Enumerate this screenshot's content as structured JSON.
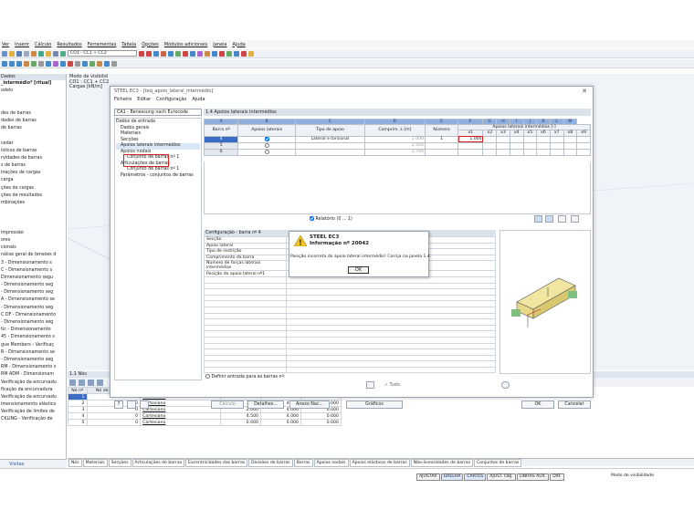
{
  "menu": [
    "Ver",
    "Inserir",
    "Cálculo",
    "Resultados",
    "Ferramentas",
    "Tabela",
    "Opções",
    "Módulos adicionais",
    "Janela",
    "Ajuda"
  ],
  "toolbar": {
    "combo": "CO1 - CC1 + CC2"
  },
  "nav": {
    "header": "Dados",
    "items": [
      "_intermédio* [ritual]",
      "odelo",
      "",
      "",
      "des de barras",
      "dades de barras",
      "de barras",
      "",
      "cedar",
      "ísticos de barras",
      "rvidades de barras",
      "s de barras",
      "inações de cargas",
      "carga",
      "ções de cargas",
      "ções de resultados",
      "mbinações",
      "",
      "",
      "",
      "impressão",
      "ores",
      "cionais",
      "nálise geral de tensões d",
      "3 - Dimensionamento s",
      "C - Dimensionamento s",
      "Dimensionamento segu",
      "- Dimensionamento seg",
      "- Dimensionamento seg",
      "A - Dimensionamento se",
      "- Dimensionamento seg",
      "C DF - Dimensionamento",
      "- Dimensionamento seg",
      "tic - Dimensionamento",
      "45 - Dimensionamento s",
      "gue Members - Verificaç",
      "R - Dimensionamento se",
      "- Dimensionamento seg",
      "RM - Dimensionamento s",
      "RM ADM - Dimensionam",
      "Verificação da encurvadu",
      "ficação da encurvadura",
      "Verificação da encurvadu",
      "imensionamento elástico",
      "Verificação de limites de",
      "CKLING - Verificação de"
    ],
    "footer": "Visitas"
  },
  "canvas_info": [
    "Modo de visibilid",
    "CO1 : CC1 + CC2",
    "Cargas [kN/m]"
  ],
  "bottom_panel": {
    "title": "1.1 Nós",
    "headers": [
      "Nó nº",
      "Nó de referência",
      "Tipo de sistema de coordenadas",
      "X [m]",
      "Y [m]",
      "Z [m]"
    ],
    "rows": [
      [
        "1",
        "0",
        "Cartesiano",
        "",
        "",
        ""
      ],
      [
        "2",
        "0",
        "Cartesiano",
        "7.200",
        "4.000",
        "0.000"
      ],
      [
        "3",
        "0",
        "Cartesiano",
        "2.000",
        "4.000",
        "0.000"
      ],
      [
        "4",
        "0",
        "Cartesiano",
        "4.500",
        "4.000",
        "0.000"
      ],
      [
        "5",
        "0",
        "Cartesiano",
        "0.000",
        "0.000",
        "0.000"
      ]
    ]
  },
  "bottom_tabs": [
    "Nós",
    "Materiais",
    "Secções",
    "Articulações de barras",
    "Excentricidades das barras",
    "Divisões de barras",
    "Barras",
    "Apoios nodais",
    "Apoios elásticos de barras",
    "Não-linearidades de barras",
    "Conjuntos de barras"
  ],
  "status": {
    "buttons": [
      "AJUSTAR",
      "GRELHA",
      "CARTES",
      "AJUST. OBJ.",
      "LINHAS AUX.",
      "DXF"
    ],
    "active": [
      "GRELHA",
      "CARTES"
    ],
    "modo": "Modo de visibilidade"
  },
  "dialog": {
    "title": "STEEL EC3 - [teq_apoio_lateral_intermédio]",
    "menu": [
      "Ficheiro",
      "Editar",
      "Configuração",
      "Ajuda"
    ],
    "combo": "CA1 - Benessung nach Eurocode",
    "section_title": "1.4 Apoios laterais intermédios",
    "tree": [
      "Dados de entrada",
      "Dados gerais",
      "Materiais",
      "Secções",
      "Apoios laterais intermédios",
      "Apoios nodais",
      "Conjunto de barras nº 1",
      "Articulações de barras",
      "Conjunto de barras nº 1",
      "Parâmetros - conjuntos de barras"
    ],
    "grid": {
      "letters": [
        "A",
        "B",
        "C",
        "D",
        "E",
        "F",
        "G",
        "H",
        "I",
        "J",
        "K",
        "L",
        "M"
      ],
      "h_barra": "Barra nº",
      "h_apoios": "Apoios laterais",
      "h_tipo": "Tipo de apoio",
      "h_compr": "Comprim. L [m]",
      "h_numero": "Número",
      "h_group": "Apoios laterais intermédios [-]",
      "xcols": [
        "x1",
        "x2",
        "x3",
        "x4",
        "x5",
        "x6",
        "x7",
        "x8",
        "x9"
      ],
      "rows": [
        {
          "n": "4",
          "checked": true,
          "tipo": "Lateral e torsional",
          "compr": "2.000",
          "num": "1",
          "x1": "1.000"
        },
        {
          "n": "5",
          "checked": false,
          "tipo": "",
          "compr": "2.500",
          "num": "",
          "x1": ""
        },
        {
          "n": "6",
          "checked": false,
          "tipo": "",
          "compr": "2.700",
          "num": "",
          "x1": ""
        }
      ]
    },
    "relatorio": "Relatório (0 ... 1)",
    "config": {
      "title": "Configuração - barra nº 4",
      "rows": [
        "Secção",
        "Apoio lateral",
        "Tipo de restrição",
        "Comprimento da barra",
        "Número de forças laterais intermédias",
        "Posição do apoio lateral nº1"
      ]
    },
    "definir": "Definir entrada para as barras nº:",
    "tudo": "Tudo",
    "buttons": {
      "calculo": "Cálculo",
      "detalhes": "Detalhes...",
      "anexo": "Anexo Nac...",
      "graficos": "Gráficos",
      "ok": "OK",
      "cancelar": "Cancelar"
    }
  },
  "message": {
    "title1": "STEEL EC3",
    "title2": "Informação nº 20042",
    "text": "Posição incorreta do apoio lateral intermédio! Corrija na janela 1.4.",
    "ok": "OK"
  }
}
